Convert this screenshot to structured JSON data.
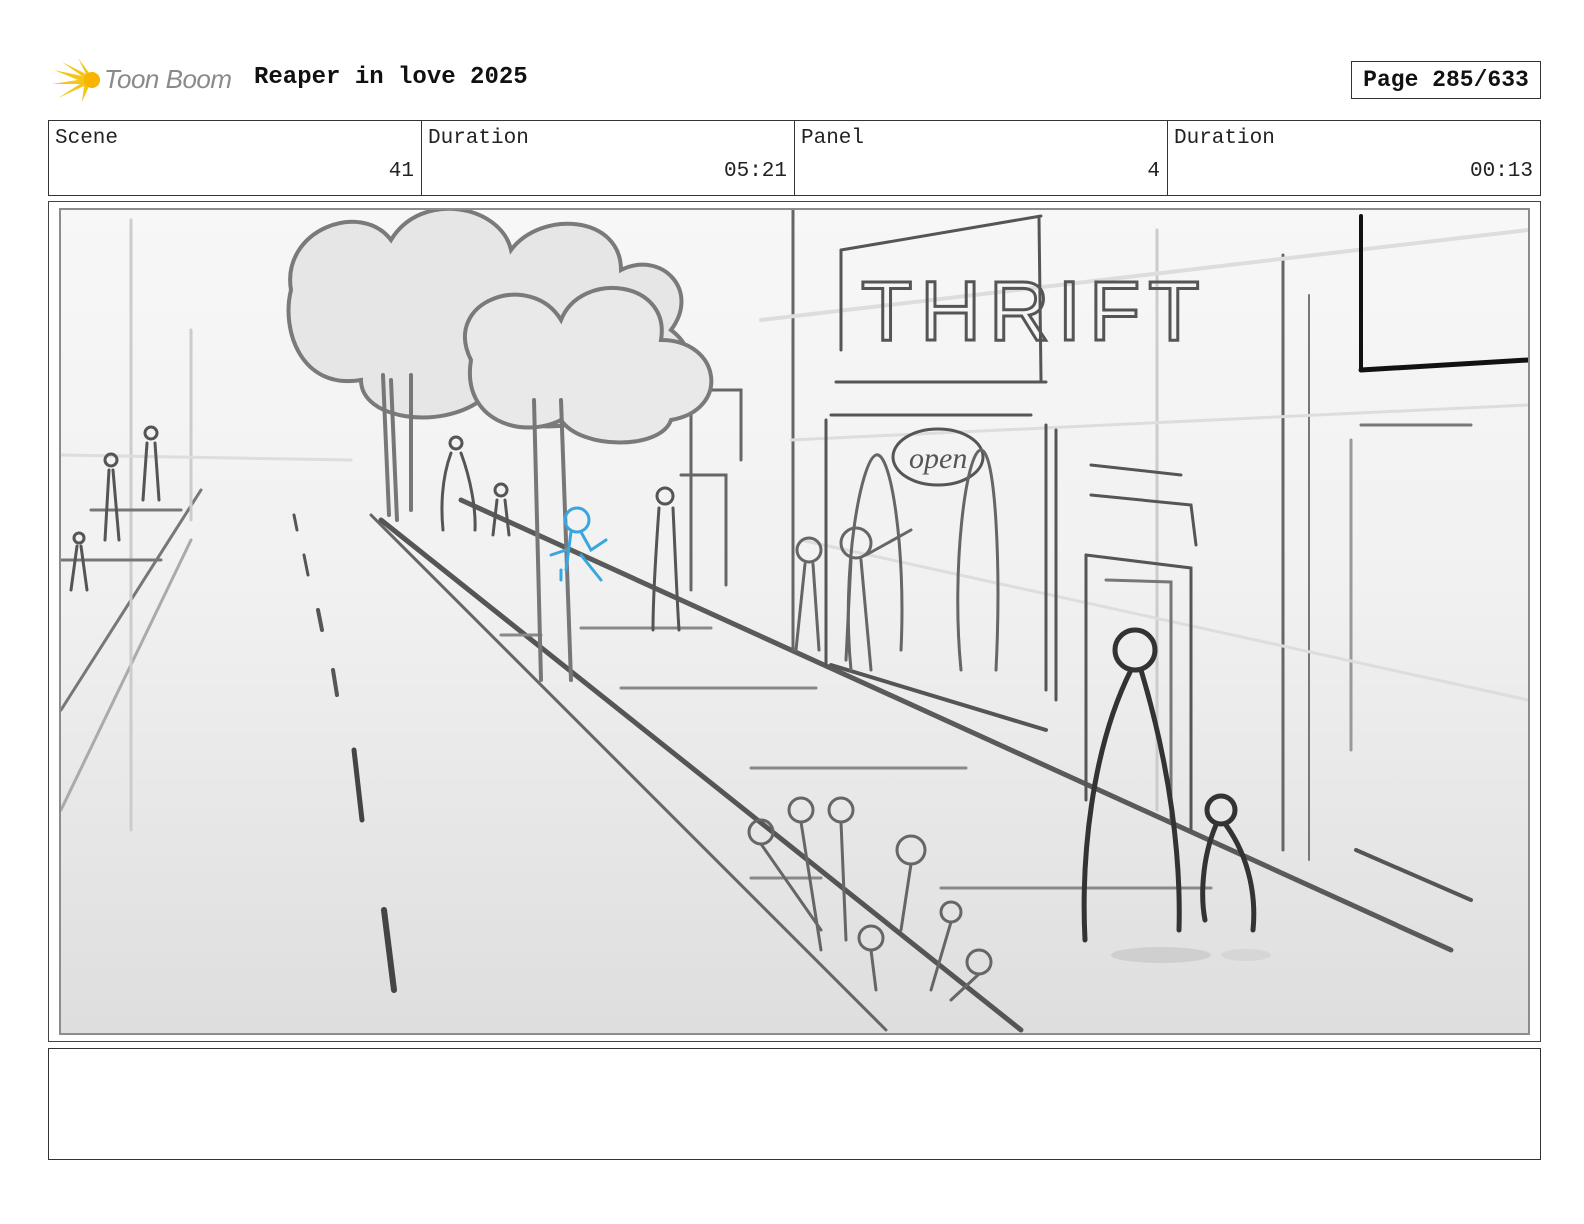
{
  "header": {
    "logo_text": "Toon Boom",
    "project_title": "Reaper in love 2025",
    "page_label": "Page 285/633"
  },
  "info": {
    "scene_label": "Scene",
    "scene_value": "41",
    "scene_duration_label": "Duration",
    "scene_duration_value": "05:21",
    "panel_label": "Panel",
    "panel_value": "4",
    "panel_duration_label": "Duration",
    "panel_duration_value": "00:13"
  },
  "panel": {
    "sign_text": "THRIFT",
    "open_sign_text": "open",
    "highlight_color": "#3aa6e0"
  },
  "notes": {
    "text": ""
  },
  "colors": {
    "logo_accent": "#f5c518",
    "border": "#333333"
  }
}
